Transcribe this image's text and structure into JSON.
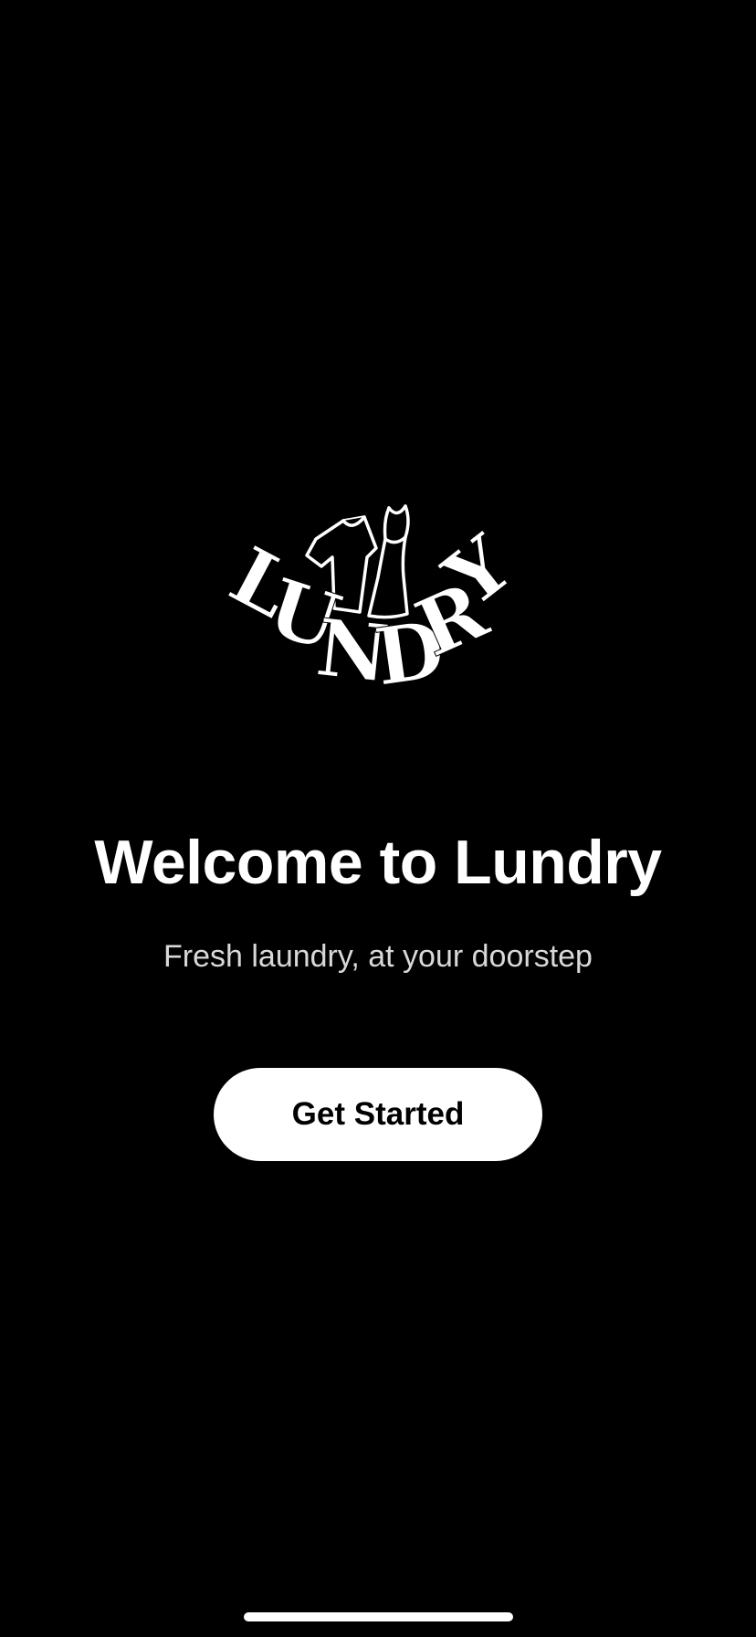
{
  "logo": {
    "wordmark": "LUNDRY",
    "icon": "laundry-clothes-icon"
  },
  "welcome": {
    "title": "Welcome to Lundry",
    "subtitle": "Fresh laundry, at your doorstep"
  },
  "cta": {
    "label": "Get Started"
  },
  "colors": {
    "background": "#000000",
    "text": "#ffffff",
    "subtitle": "#d8d8d8",
    "button_bg": "#ffffff",
    "button_text": "#000000"
  }
}
